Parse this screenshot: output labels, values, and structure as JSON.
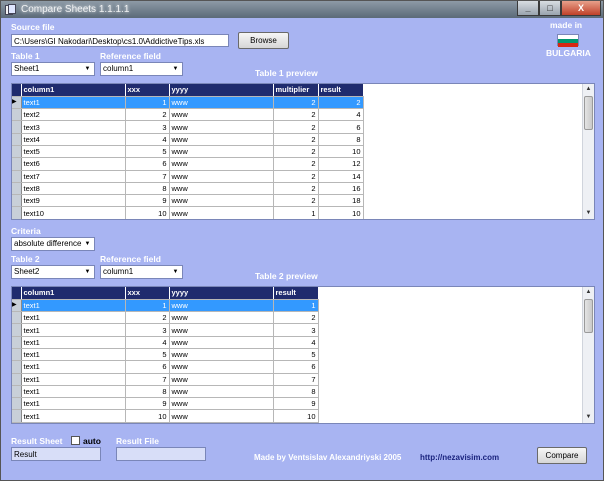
{
  "window": {
    "title": "Compare Sheets 1.1.1.1",
    "controls": [
      "_",
      "□",
      "X"
    ]
  },
  "source": {
    "label": "Source file",
    "path": "C:\\Users\\GI Nakodari\\Desktop\\cs1.0\\AddictiveTips.xls",
    "browse_label": "Browse"
  },
  "badge": {
    "made_in": "made in",
    "country": "BULGARIA",
    "flag_colors": [
      "#ffffff",
      "#00966e",
      "#d62612"
    ]
  },
  "table1": {
    "label": "Table 1",
    "sheet": "Sheet1",
    "ref_label": "Reference field",
    "ref_value": "column1",
    "preview_label": "Table 1 preview",
    "columns": [
      "column1",
      "xxx",
      "yyyy",
      "multiplier",
      "result"
    ],
    "rows": [
      [
        "text1",
        "1",
        "www",
        "2",
        "2"
      ],
      [
        "text2",
        "2",
        "www",
        "2",
        "4"
      ],
      [
        "text3",
        "3",
        "www",
        "2",
        "6"
      ],
      [
        "text4",
        "4",
        "www",
        "2",
        "8"
      ],
      [
        "text5",
        "5",
        "www",
        "2",
        "10"
      ],
      [
        "text6",
        "6",
        "www",
        "2",
        "12"
      ],
      [
        "text7",
        "7",
        "www",
        "2",
        "14"
      ],
      [
        "text8",
        "8",
        "www",
        "2",
        "16"
      ],
      [
        "text9",
        "9",
        "www",
        "2",
        "18"
      ],
      [
        "text10",
        "10",
        "www",
        "1",
        "10"
      ]
    ],
    "selected_row": 0
  },
  "criteria": {
    "label": "Criteria",
    "value": "absolute difference"
  },
  "table2": {
    "label": "Table 2",
    "sheet": "Sheet2",
    "ref_label": "Reference field",
    "ref_value": "column1",
    "preview_label": "Table 2 preview",
    "columns": [
      "column1",
      "xxx",
      "yyyy",
      "result"
    ],
    "rows": [
      [
        "text1",
        "1",
        "www",
        "1"
      ],
      [
        "text1",
        "2",
        "www",
        "2"
      ],
      [
        "text1",
        "3",
        "www",
        "3"
      ],
      [
        "text1",
        "4",
        "www",
        "4"
      ],
      [
        "text1",
        "5",
        "www",
        "5"
      ],
      [
        "text1",
        "6",
        "www",
        "6"
      ],
      [
        "text1",
        "7",
        "www",
        "7"
      ],
      [
        "text1",
        "8",
        "www",
        "8"
      ],
      [
        "text1",
        "9",
        "www",
        "9"
      ],
      [
        "text1",
        "10",
        "www",
        "10"
      ]
    ],
    "selected_row": 0
  },
  "footer": {
    "result_sheet_label": "Result Sheet",
    "auto_label": "auto",
    "auto_checked": false,
    "result_sheet_value": "Result",
    "result_file_label": "Result File",
    "result_file_value": "",
    "credit": "Made by Ventsislav Alexandriyski 2005",
    "link": "http://nezavisim.com",
    "compare_label": "Compare"
  }
}
